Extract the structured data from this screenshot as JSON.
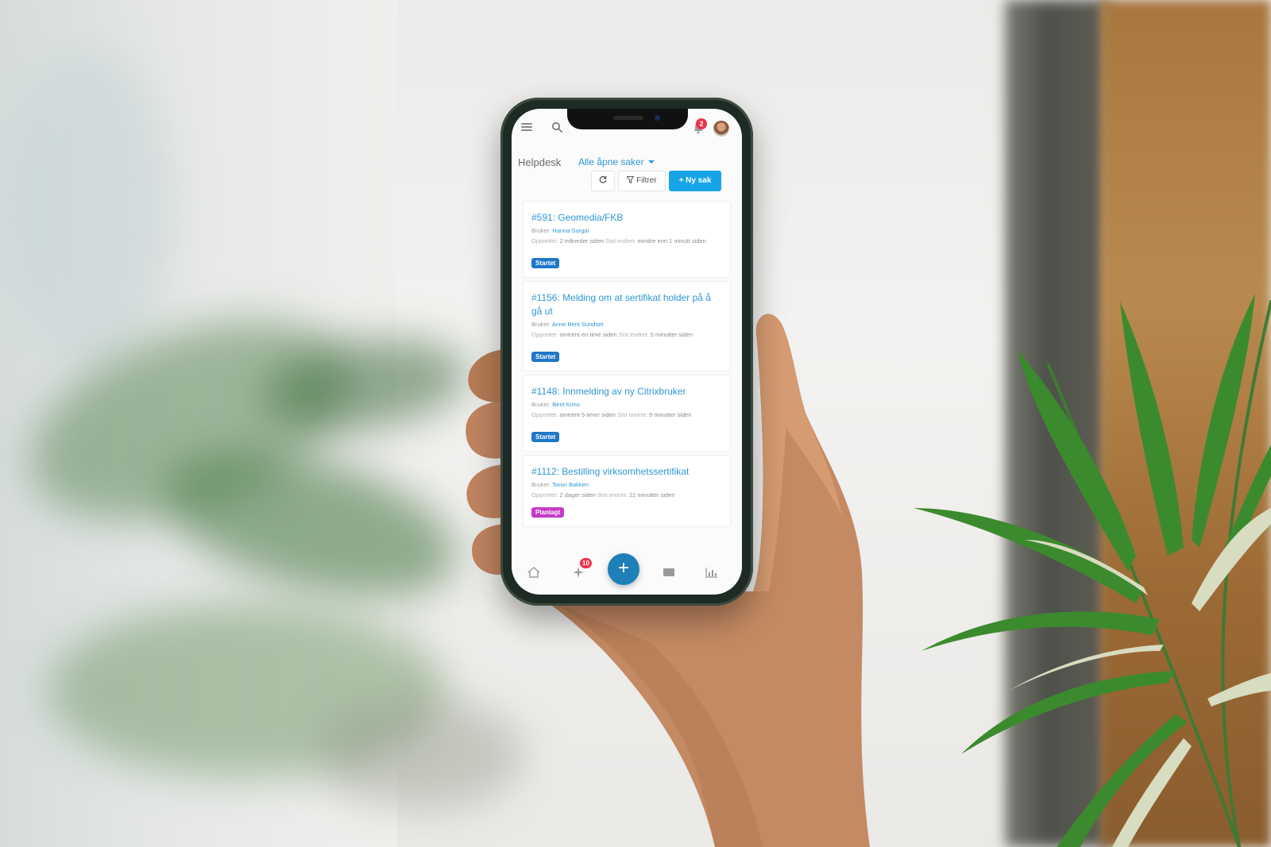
{
  "topbar": {
    "notification_count": "2"
  },
  "header": {
    "title": "Helpdesk",
    "view_selector": "Alle åpne saker"
  },
  "toolbar": {
    "filter_label": "Filtrer",
    "new_case_label": "+ Ny sak"
  },
  "labels": {
    "user": "Bruker:",
    "created": "Opprettet:",
    "last_changed": "Sist endret:"
  },
  "cases": [
    {
      "title": "#591: Geomedia/FKB",
      "user": "Hanna Surgai",
      "created": "2 måneder siden",
      "last_changed": "mindre enn 1 minutt siden",
      "status": "Startet"
    },
    {
      "title": "#1156: Melding om at sertifikat holder på å gå ut",
      "user": "Anne Berit Sundset",
      "created": "omtrent en time siden",
      "last_changed": "5 minutter siden",
      "status": "Startet"
    },
    {
      "title": "#1148: Innmelding av ny Citrixbruker",
      "user": "Berit Kimo",
      "created": "omtrent 5 timer siden",
      "last_changed": "9 minutter siden",
      "status": "Startet"
    },
    {
      "title": "#1112: Bestilling virksomhetssertifikat",
      "user": "Torun Bakken",
      "created": "2 dager siden",
      "last_changed": "22 minutter siden",
      "status": "Planlagt"
    }
  ],
  "bottom_nav": {
    "activity_badge": "10",
    "fab_label": "+"
  },
  "colors": {
    "accent": "#2f97d3",
    "primary_button": "#17a4e6",
    "status_started": "#1f77c9",
    "status_planned": "#c53bc9",
    "badge": "#e8344a",
    "fab": "#1f7fb8"
  }
}
